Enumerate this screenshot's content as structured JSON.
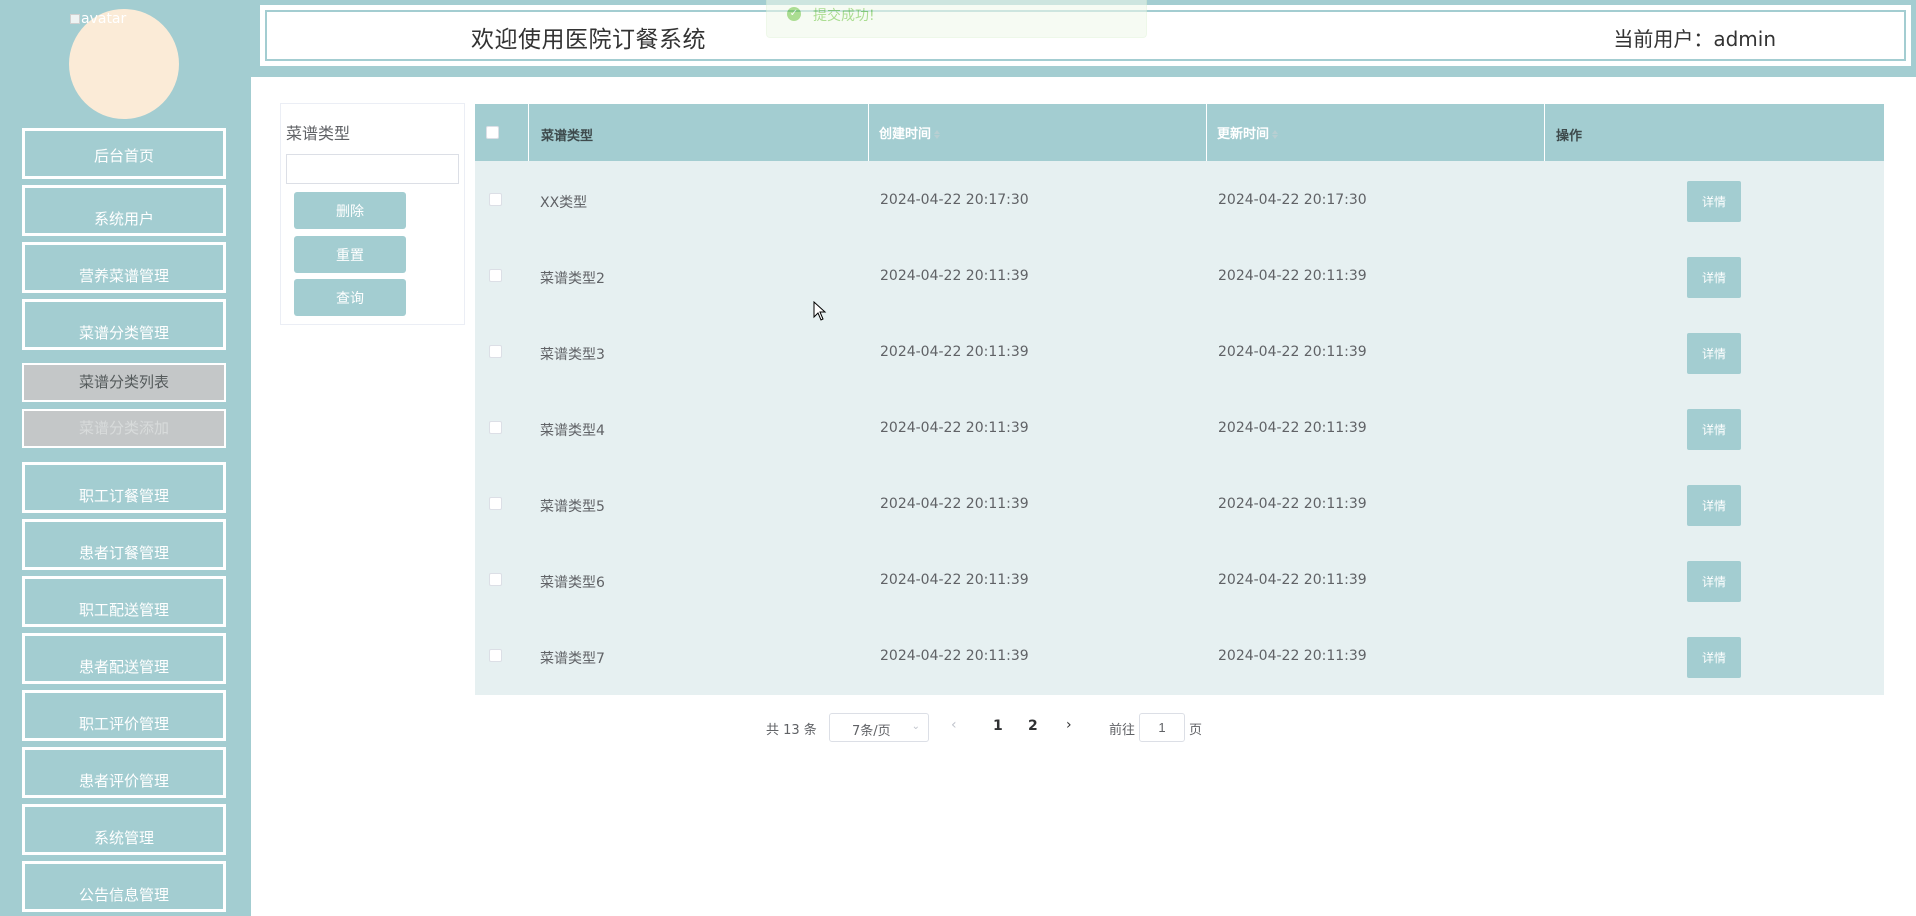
{
  "colors": {
    "primary": "#a3cdd1",
    "table_bg": "#e6f0f1",
    "success": "#67c23a"
  },
  "sidebar": {
    "avatar_alt": "avatar",
    "items": [
      {
        "label": "后台首页"
      },
      {
        "label": "系统用户"
      },
      {
        "label": "营养菜谱管理"
      },
      {
        "label": "菜谱分类管理"
      },
      {
        "label": "菜谱分类列表"
      },
      {
        "label": "菜谱分类添加"
      },
      {
        "label": "职工订餐管理"
      },
      {
        "label": "患者订餐管理"
      },
      {
        "label": "职工配送管理"
      },
      {
        "label": "患者配送管理"
      },
      {
        "label": "职工评价管理"
      },
      {
        "label": "患者评价管理"
      },
      {
        "label": "系统管理"
      },
      {
        "label": "公告信息管理"
      }
    ]
  },
  "header": {
    "title": "欢迎使用医院订餐系统",
    "current_user": "当前用户：admin"
  },
  "toast": {
    "message": "提交成功!",
    "icon": "success-check-icon"
  },
  "search": {
    "label": "菜谱类型",
    "value": "",
    "buttons": {
      "delete": "删除",
      "reset": "重置",
      "query": "查询"
    }
  },
  "table": {
    "columns": [
      "菜谱类型",
      "创建时间",
      "更新时间",
      "操作"
    ],
    "action_label": "详情",
    "rows": [
      {
        "type": "XX类型",
        "created": "2024-04-22 20:17:30",
        "updated": "2024-04-22 20:17:30"
      },
      {
        "type": "菜谱类型2",
        "created": "2024-04-22 20:11:39",
        "updated": "2024-04-22 20:11:39"
      },
      {
        "type": "菜谱类型3",
        "created": "2024-04-22 20:11:39",
        "updated": "2024-04-22 20:11:39"
      },
      {
        "type": "菜谱类型4",
        "created": "2024-04-22 20:11:39",
        "updated": "2024-04-22 20:11:39"
      },
      {
        "type": "菜谱类型5",
        "created": "2024-04-22 20:11:39",
        "updated": "2024-04-22 20:11:39"
      },
      {
        "type": "菜谱类型6",
        "created": "2024-04-22 20:11:39",
        "updated": "2024-04-22 20:11:39"
      },
      {
        "type": "菜谱类型7",
        "created": "2024-04-22 20:11:39",
        "updated": "2024-04-22 20:11:39"
      }
    ]
  },
  "pagination": {
    "total": "共 13 条",
    "page_size": "7条/页",
    "pages": [
      "1",
      "2"
    ],
    "current_page": "1",
    "goto_label": "前往",
    "goto_value": "1",
    "page_suffix": "页"
  }
}
